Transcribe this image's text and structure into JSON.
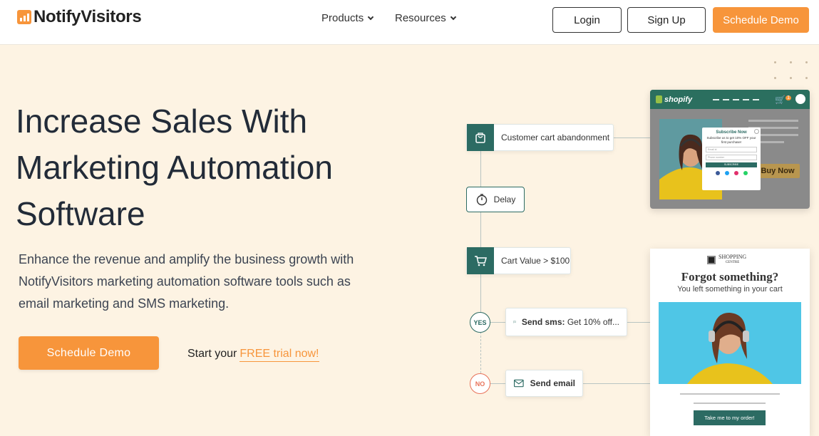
{
  "nav": {
    "logo": "NotifyVisitors",
    "products_label": "Products",
    "resources_label": "Resources",
    "login_label": "Login",
    "signup_label": "Sign Up",
    "demo_label": "Schedule Demo"
  },
  "hero": {
    "title_line1": "Increase Sales With",
    "title_line2": "Marketing Automation",
    "title_line3": "Software",
    "description": "Enhance the revenue and amplify the business growth with NotifyVisitors marketing automation software tools such as email marketing and SMS marketing.",
    "cta_label": "Schedule Demo",
    "trial_prefix": "Start your",
    "trial_link": "FREE trial now!"
  },
  "flow": {
    "cart_abandon": "Customer cart abandonment",
    "delay": "Delay",
    "cart_value": "Cart Value > $100",
    "yes": "YES",
    "no": "NO",
    "sms_bold": "Send sms:",
    "sms_rest": "Get 10% off...",
    "email": "Send email"
  },
  "shopify_card": {
    "logo": "shopify",
    "cart_count": "1",
    "popup_title": "Subscribe Now",
    "popup_sub": "Subscribe us to get 10% OFF your first purchase!",
    "field_email": "Email id",
    "field_phone": "Phone number",
    "subscribe": "SUBSCRIBE",
    "buy_now": "Buy Now"
  },
  "email_card": {
    "brand_line1": "SHOPPING",
    "brand_line2": "CENTRE",
    "headline": "Forgot something?",
    "subline": "You left something in your cart",
    "button": "Take me to my order!"
  },
  "colors": {
    "accent": "#f7953b",
    "teal": "#2c6b63",
    "background": "#fdf3e3"
  }
}
